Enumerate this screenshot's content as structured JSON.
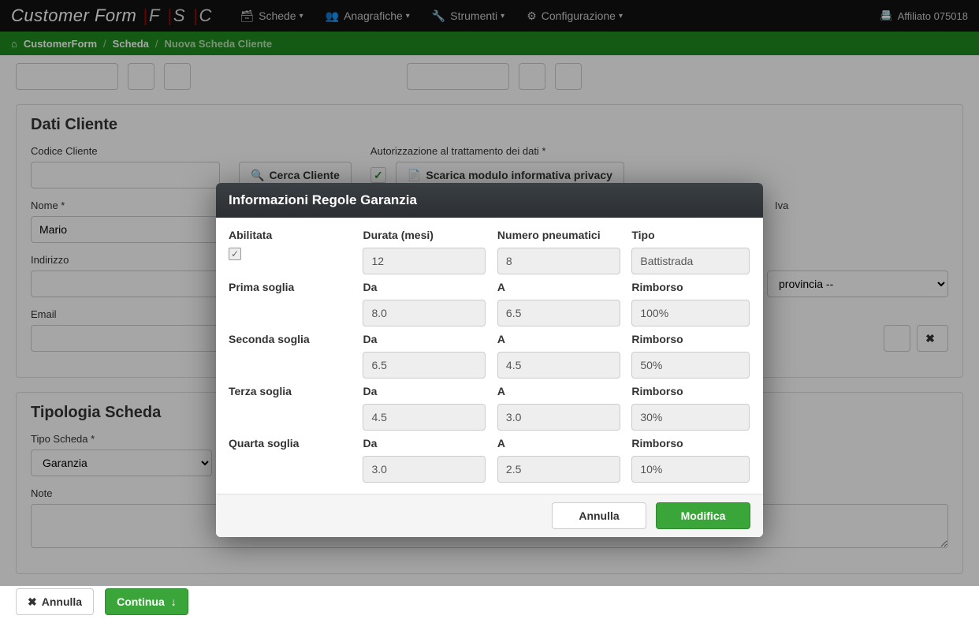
{
  "nav": {
    "brand": "Customer Form",
    "fsc_bar": "|",
    "fsc_f": "F",
    "fsc_s": "S",
    "fsc_c": "C",
    "items": [
      {
        "label": "Schede"
      },
      {
        "label": "Anagrafiche"
      },
      {
        "label": "Strumenti"
      },
      {
        "label": "Configurazione"
      }
    ],
    "affiliato": "Affiliato 075018"
  },
  "breadcrumb": {
    "root": "CustomerForm",
    "mid": "Scheda",
    "current": "Nuova Scheda Cliente"
  },
  "clientPanel": {
    "title": "Dati Cliente",
    "codiceLabel": "Codice Cliente",
    "codiceValue": "",
    "cercaBtn": "Cerca Cliente",
    "autLabel": "Autorizzazione al trattamento dei dati *",
    "pdfBtn": "Scarica modulo informativa privacy",
    "nomeLabel": "Nome *",
    "nomeValue": "Mario",
    "ivaLabel": "Iva",
    "indirizzoLabel": "Indirizzo",
    "indirizzoValue": "",
    "provinciaPlaceholder": "provincia --",
    "emailLabel": "Email",
    "emailValue": ""
  },
  "tipologiaPanel": {
    "title": "Tipologia Scheda",
    "tipoLabel": "Tipo Scheda *",
    "tipoValue": "Garanzia",
    "noteLabel": "Note",
    "noteValue": ""
  },
  "actions": {
    "annulla": "Annulla",
    "continua": "Continua"
  },
  "modal": {
    "title": "Informazioni Regole Garanzia",
    "headers": {
      "abilitata": "Abilitata",
      "durata": "Durata (mesi)",
      "numero": "Numero pneumatici",
      "tipo": "Tipo",
      "da": "Da",
      "a": "A",
      "rimborso": "Rimborso"
    },
    "top": {
      "durata": "12",
      "numero": "8",
      "tipo": "Battistrada"
    },
    "soglie": [
      {
        "name": "Prima soglia",
        "da": "8.0",
        "a": "6.5",
        "rimborso": "100%"
      },
      {
        "name": "Seconda soglia",
        "da": "6.5",
        "a": "4.5",
        "rimborso": "50%"
      },
      {
        "name": "Terza soglia",
        "da": "4.5",
        "a": "3.0",
        "rimborso": "30%"
      },
      {
        "name": "Quarta soglia",
        "da": "3.0",
        "a": "2.5",
        "rimborso": "10%"
      }
    ],
    "buttons": {
      "annulla": "Annulla",
      "modifica": "Modifica"
    }
  }
}
